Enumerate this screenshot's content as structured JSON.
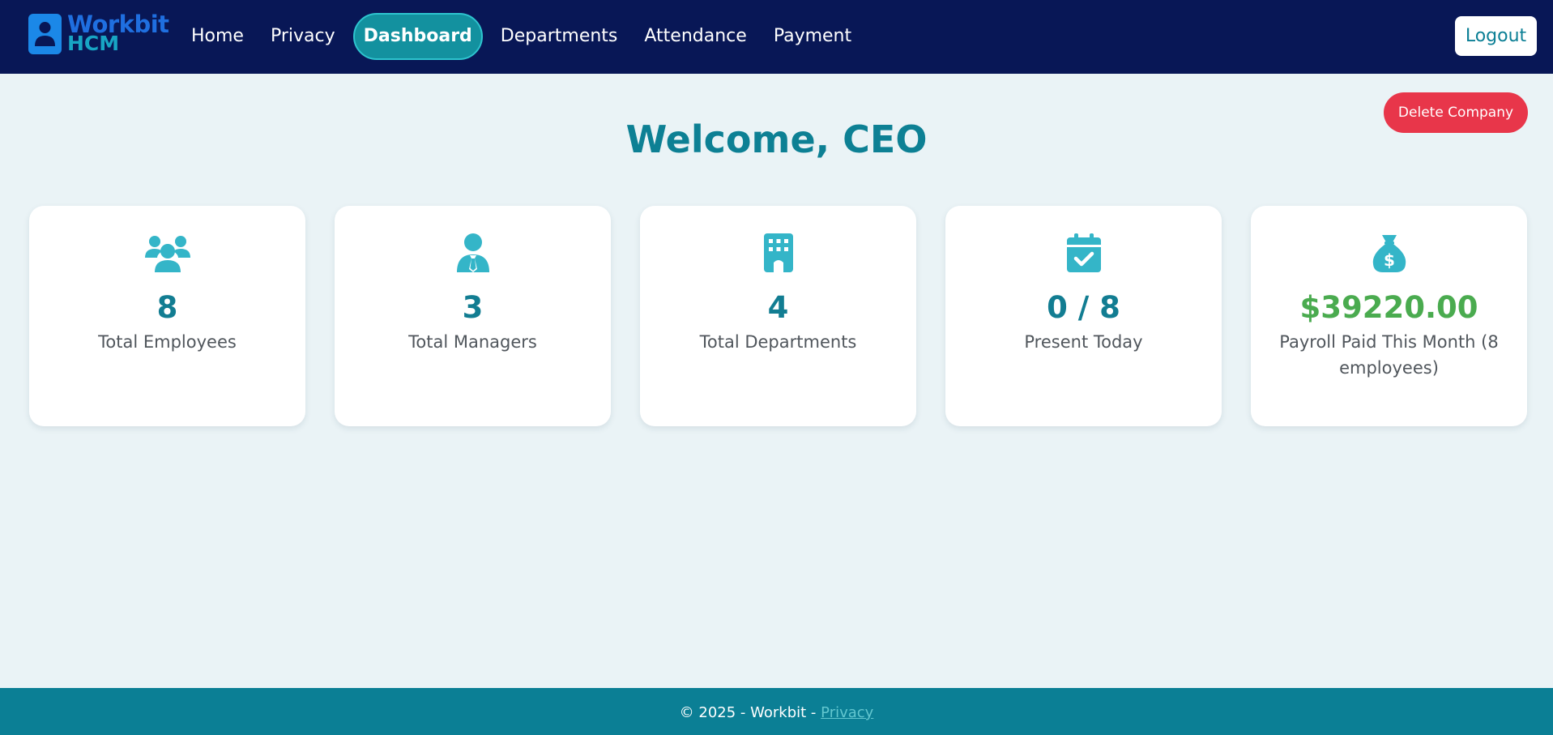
{
  "brand": {
    "line1": "Workbit",
    "line2": "HCM"
  },
  "nav": {
    "items": [
      {
        "label": "Home",
        "active": false
      },
      {
        "label": "Privacy",
        "active": false
      },
      {
        "label": "Dashboard",
        "active": true
      },
      {
        "label": "Departments",
        "active": false
      },
      {
        "label": "Attendance",
        "active": false
      },
      {
        "label": "Payment",
        "active": false
      }
    ],
    "logout_label": "Logout"
  },
  "actions": {
    "delete_company_label": "Delete Company"
  },
  "welcome": {
    "title": "Welcome, CEO"
  },
  "stats": [
    {
      "icon": "users-icon",
      "value": "8",
      "label": "Total Employees"
    },
    {
      "icon": "user-tie-icon",
      "value": "3",
      "label": "Total Managers"
    },
    {
      "icon": "building-icon",
      "value": "4",
      "label": "Total Departments"
    },
    {
      "icon": "calendar-check-icon",
      "value": "0 / 8",
      "label": "Present Today"
    },
    {
      "icon": "money-bag-icon",
      "value": "$39220.00",
      "label": "Payroll Paid This Month (8 employees)"
    }
  ],
  "footer": {
    "text": "© 2025 - Workbit - ",
    "link_label": "Privacy"
  },
  "colors": {
    "navbar": "#081756",
    "accent": "#0d8094",
    "icon": "#34b5c8",
    "danger": "#e8364a",
    "success": "#4aab4f",
    "background": "#eaf3f6"
  }
}
